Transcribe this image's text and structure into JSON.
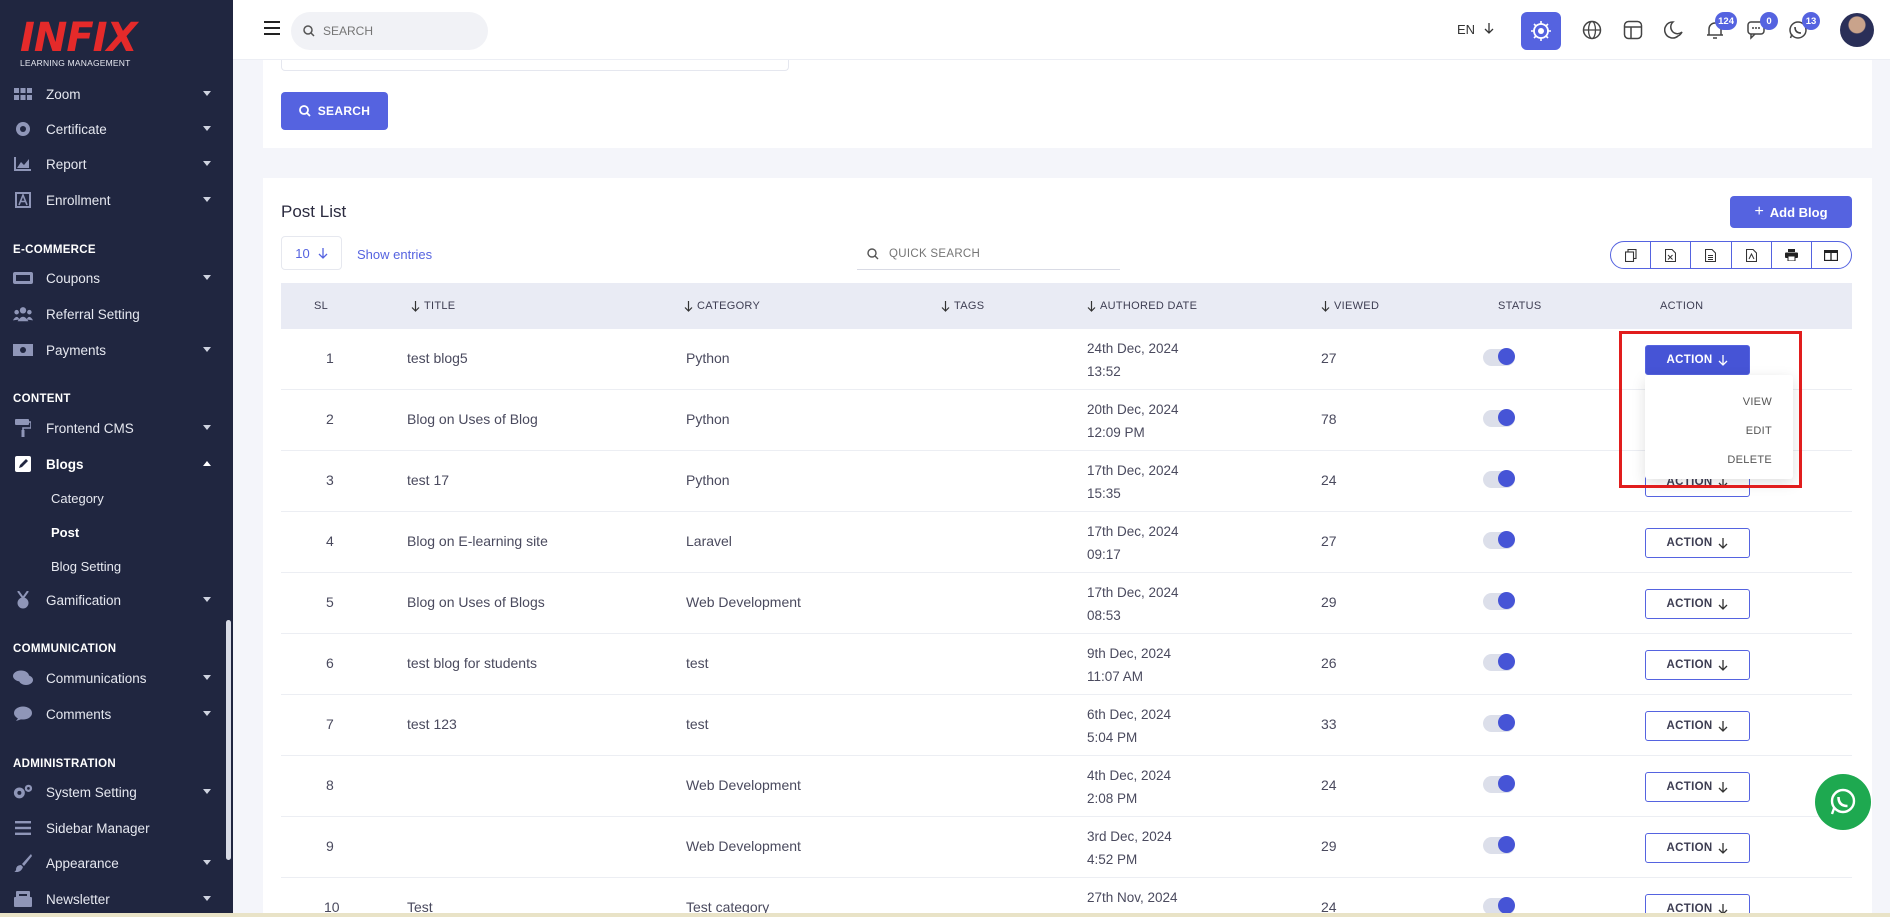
{
  "sidebar": {
    "logo_main": "INFIX",
    "logo_sub": "LEARNING MANAGEMENT",
    "items": [
      {
        "label": "Zoom",
        "icon": "zoom-grid-icon"
      },
      {
        "label": "Certificate",
        "icon": "certificate-icon"
      },
      {
        "label": "Report",
        "icon": "report-chart-icon"
      },
      {
        "label": "Enrollment",
        "icon": "enrollment-icon"
      },
      {
        "label": "Coupons",
        "icon": "coupon-icon"
      },
      {
        "label": "Referral Setting",
        "icon": "referral-users-icon"
      },
      {
        "label": "Payments",
        "icon": "payments-icon"
      },
      {
        "label": "Frontend CMS",
        "icon": "paint-roller-icon"
      },
      {
        "label": "Blogs",
        "icon": "blog-edit-icon"
      },
      {
        "label": "Gamification",
        "icon": "medal-icon"
      },
      {
        "label": "Communications",
        "icon": "chat-bubbles-icon"
      },
      {
        "label": "Comments",
        "icon": "comment-icon"
      },
      {
        "label": "System Setting",
        "icon": "gears-icon"
      },
      {
        "label": "Sidebar Manager",
        "icon": "bars-icon"
      },
      {
        "label": "Appearance",
        "icon": "brush-icon"
      },
      {
        "label": "Newsletter",
        "icon": "newsletter-icon"
      }
    ],
    "headings": {
      "ecommerce": "E-COMMERCE",
      "content": "CONTENT",
      "communication": "COMMUNICATION",
      "administration": "ADMINISTRATION"
    },
    "blog_sub": [
      {
        "label": "Category"
      },
      {
        "label": "Post"
      },
      {
        "label": "Blog Setting"
      }
    ]
  },
  "topbar": {
    "search_placeholder": "SEARCH",
    "language": "EN",
    "badges": {
      "notifications": "124",
      "messages": "0",
      "whatsapp": "13"
    }
  },
  "filter": {
    "search_button": "SEARCH"
  },
  "post_list": {
    "title": "Post List",
    "add_button": "Add Blog",
    "entries_value": "10",
    "entries_label": "Show entries",
    "quick_search_placeholder": "QUICK SEARCH",
    "columns": [
      "SL",
      "TITLE",
      "CATEGORY",
      "TAGS",
      "AUTHORED DATE",
      "VIEWED",
      "STATUS",
      "ACTION"
    ],
    "rows": [
      {
        "sl": "1",
        "title": "test blog5",
        "category": "Python",
        "date": "24th Dec, 2024",
        "time": "13:52",
        "viewed": "27",
        "status": true
      },
      {
        "sl": "2",
        "title": "Blog on Uses of Blog",
        "category": "Python",
        "date": "20th Dec, 2024",
        "time": "12:09 PM",
        "viewed": "78",
        "status": true
      },
      {
        "sl": "3",
        "title": "test 17",
        "category": "Python",
        "date": "17th Dec, 2024",
        "time": "15:35",
        "viewed": "24",
        "status": true
      },
      {
        "sl": "4",
        "title": "Blog on E-learning site",
        "category": "Laravel",
        "date": "17th Dec, 2024",
        "time": "09:17",
        "viewed": "27",
        "status": true
      },
      {
        "sl": "5",
        "title": "Blog on Uses of Blogs",
        "category": "Web Development",
        "date": "17th Dec, 2024",
        "time": "08:53",
        "viewed": "29",
        "status": true
      },
      {
        "sl": "6",
        "title": "test blog for students",
        "category": "test",
        "date": "9th Dec, 2024",
        "time": "11:07 AM",
        "viewed": "26",
        "status": true
      },
      {
        "sl": "7",
        "title": "test 123",
        "category": "test",
        "date": "6th Dec, 2024",
        "time": "5:04 PM",
        "viewed": "33",
        "status": true
      },
      {
        "sl": "8",
        "title": "",
        "category": "Web Development",
        "date": "4th Dec, 2024",
        "time": "2:08 PM",
        "viewed": "24",
        "status": true
      },
      {
        "sl": "9",
        "title": "",
        "category": "Web Development",
        "date": "3rd Dec, 2024",
        "time": "4:52 PM",
        "viewed": "29",
        "status": true
      },
      {
        "sl": "10",
        "title": "Test",
        "category": "Test category",
        "date": "27th Nov, 2024",
        "time": "",
        "viewed": "24",
        "status": true
      }
    ],
    "action_label": "ACTION",
    "dropdown": [
      "VIEW",
      "EDIT",
      "DELETE"
    ]
  },
  "colors": {
    "primary": "#5563e0",
    "sidebar": "#202640",
    "highlight": "#e11d1d",
    "whatsapp": "#1ea950"
  }
}
